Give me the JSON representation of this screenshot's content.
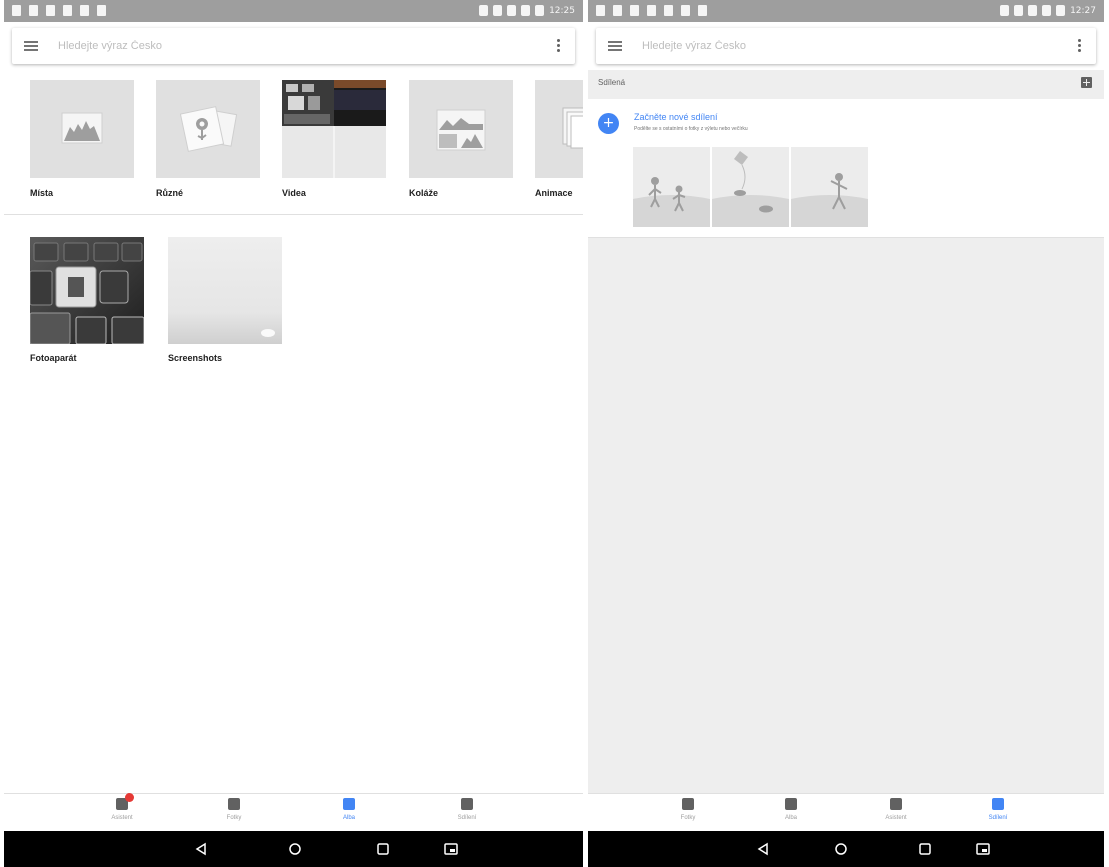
{
  "left_screen": {
    "statusbar": {
      "time": "12:25"
    },
    "search": {
      "placeholder": "Hledejte výraz Česko"
    },
    "categories": [
      {
        "label": "Místa",
        "icon": "landscape-icon"
      },
      {
        "label": "Různé",
        "icon": "flower-photos-icon"
      },
      {
        "label": "Videa",
        "icon": "video-thumbnail"
      },
      {
        "label": "Koláže",
        "icon": "collage-icon"
      },
      {
        "label": "Animace",
        "icon": "stacked-photos-icon"
      }
    ],
    "albums": [
      {
        "label": "Fotoaparát"
      },
      {
        "label": "Screenshots"
      }
    ],
    "bottom_nav": [
      {
        "label": "Asistent",
        "icon": "assistant-icon",
        "active": false,
        "badge": true
      },
      {
        "label": "Fotky",
        "icon": "photos-icon",
        "active": false
      },
      {
        "label": "Alba",
        "icon": "albums-icon",
        "active": true
      },
      {
        "label": "Sdílení",
        "icon": "sharing-icon",
        "active": false
      }
    ]
  },
  "right_screen": {
    "statusbar": {
      "time": "12:27"
    },
    "search": {
      "placeholder": "Hledejte výraz Česko"
    },
    "shared": {
      "title": "Sdílená",
      "start_title": "Začněte nové sdílení",
      "start_subtitle": "Podělte se s ostatními o fotky z výletu nebo večírku"
    },
    "bottom_nav": [
      {
        "label": "Fotky",
        "icon": "photos-icon",
        "active": false
      },
      {
        "label": "Alba",
        "icon": "albums-icon",
        "active": false
      },
      {
        "label": "Asistent",
        "icon": "assistant-icon",
        "active": false
      },
      {
        "label": "Sdílení",
        "icon": "sharing-icon",
        "active": true
      }
    ]
  },
  "colors": {
    "accent": "#4285f4",
    "statusbar": "#9e9e9e",
    "badge": "#e53935",
    "tile_placeholder": "#e0e0e0"
  }
}
